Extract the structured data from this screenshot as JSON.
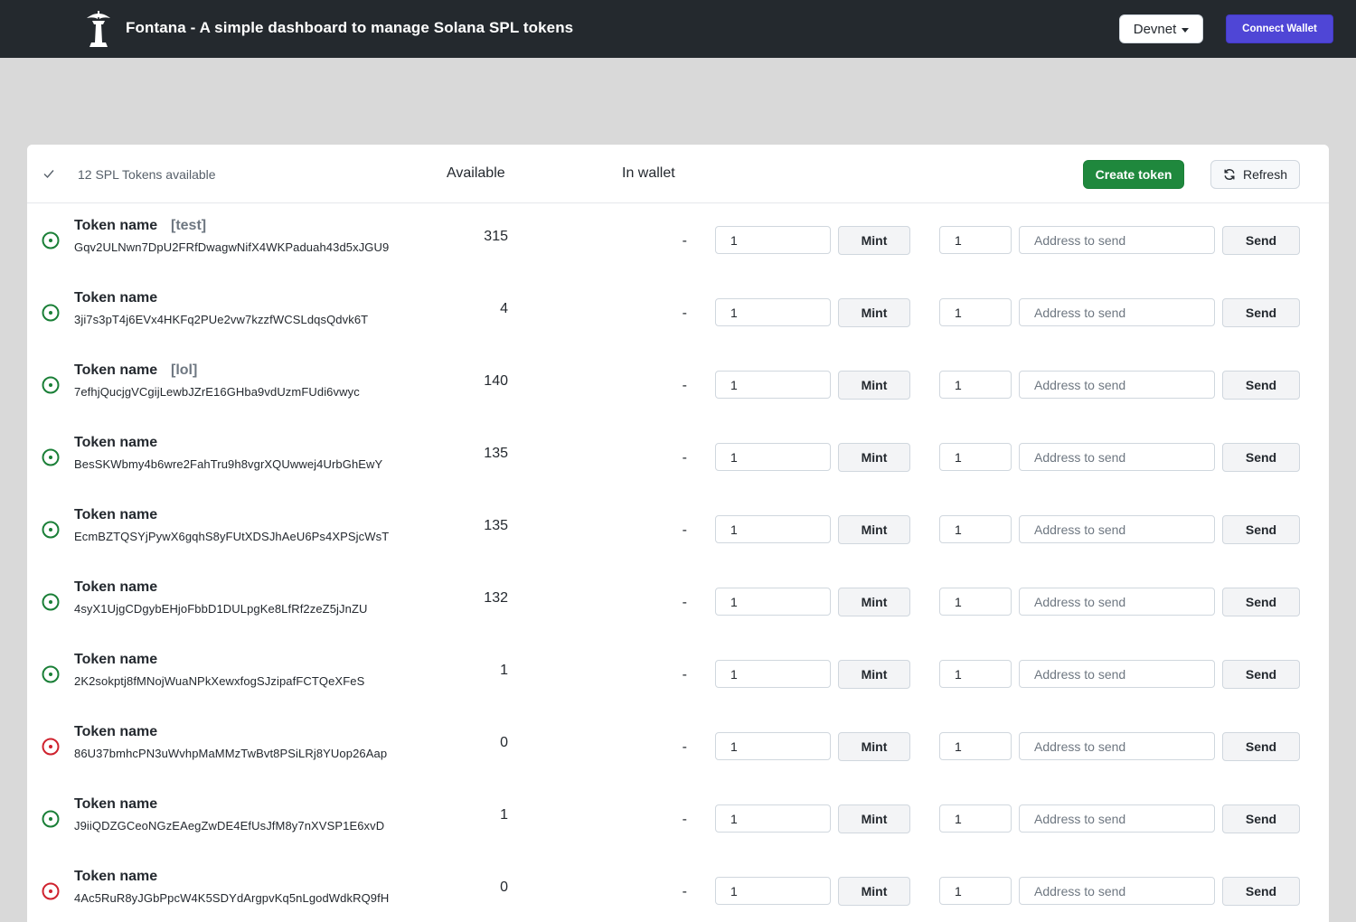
{
  "navbar": {
    "title": "Fontana - A simple dashboard to manage Solana SPL tokens",
    "network": "Devnet",
    "connect_label": "Connect Wallet",
    "logo_icon": "fountain-logo-icon"
  },
  "header": {
    "count_label": "12 SPL Tokens available",
    "available_label": "Available",
    "in_wallet_label": "In wallet",
    "create_label": "Create token",
    "refresh_label": "Refresh"
  },
  "colors": {
    "active": "#1a7f37",
    "inactive": "#cf222e",
    "create": "#1f883d",
    "connect": "#4f46d6",
    "navbar": "#24292e"
  },
  "tokens": [
    {
      "name": "Token name",
      "tag": "[test]",
      "address": "Gqv2ULNwn7DpU2FRfDwagwNifX4WKPaduah43d5xJGU9",
      "available": "315",
      "in_wallet": "-",
      "mint_qty": "1",
      "mint_label": "Mint",
      "send_qty": "1",
      "address_placeholder": "Address to send",
      "send_label": "Send",
      "status": "active"
    },
    {
      "name": "Token name",
      "tag": "",
      "address": "3ji7s3pT4j6EVx4HKFq2PUe2vw7kzzfWCSLdqsQdvk6T",
      "available": "4",
      "in_wallet": "-",
      "mint_qty": "1",
      "mint_label": "Mint",
      "send_qty": "1",
      "address_placeholder": "Address to send",
      "send_label": "Send",
      "status": "active"
    },
    {
      "name": "Token name",
      "tag": "[lol]",
      "address": "7efhjQucjgVCgijLewbJZrE16GHba9vdUzmFUdi6vwyc",
      "available": "140",
      "in_wallet": "-",
      "mint_qty": "1",
      "mint_label": "Mint",
      "send_qty": "1",
      "address_placeholder": "Address to send",
      "send_label": "Send",
      "status": "active"
    },
    {
      "name": "Token name",
      "tag": "",
      "address": "BesSKWbmy4b6wre2FahTru9h8vgrXQUwwej4UrbGhEwY",
      "available": "135",
      "in_wallet": "-",
      "mint_qty": "1",
      "mint_label": "Mint",
      "send_qty": "1",
      "address_placeholder": "Address to send",
      "send_label": "Send",
      "status": "active"
    },
    {
      "name": "Token name",
      "tag": "",
      "address": "EcmBZTQSYjPywX6gqhS8yFUtXDSJhAeU6Ps4XPSjcWsT",
      "available": "135",
      "in_wallet": "-",
      "mint_qty": "1",
      "mint_label": "Mint",
      "send_qty": "1",
      "address_placeholder": "Address to send",
      "send_label": "Send",
      "status": "active"
    },
    {
      "name": "Token name",
      "tag": "",
      "address": "4syX1UjgCDgybEHjoFbbD1DULpgKe8LfRf2zeZ5jJnZU",
      "available": "132",
      "in_wallet": "-",
      "mint_qty": "1",
      "mint_label": "Mint",
      "send_qty": "1",
      "address_placeholder": "Address to send",
      "send_label": "Send",
      "status": "active"
    },
    {
      "name": "Token name",
      "tag": "",
      "address": "2K2sokptj8fMNojWuaNPkXewxfogSJzipafFCTQeXFeS",
      "available": "1",
      "in_wallet": "-",
      "mint_qty": "1",
      "mint_label": "Mint",
      "send_qty": "1",
      "address_placeholder": "Address to send",
      "send_label": "Send",
      "status": "active"
    },
    {
      "name": "Token name",
      "tag": "",
      "address": "86U37bmhcPN3uWvhpMaMMzTwBvt8PSiLRj8YUop26Aap",
      "available": "0",
      "in_wallet": "-",
      "mint_qty": "1",
      "mint_label": "Mint",
      "send_qty": "1",
      "address_placeholder": "Address to send",
      "send_label": "Send",
      "status": "inactive"
    },
    {
      "name": "Token name",
      "tag": "",
      "address": "J9iiQDZGCeoNGzEAegZwDE4EfUsJfM8y7nXVSP1E6xvD",
      "available": "1",
      "in_wallet": "-",
      "mint_qty": "1",
      "mint_label": "Mint",
      "send_qty": "1",
      "address_placeholder": "Address to send",
      "send_label": "Send",
      "status": "active"
    },
    {
      "name": "Token name",
      "tag": "",
      "address": "4Ac5RuR8yJGbPpcW4K5SDYdArgpvKq5nLgodWdkRQ9fH",
      "available": "0",
      "in_wallet": "-",
      "mint_qty": "1",
      "mint_label": "Mint",
      "send_qty": "1",
      "address_placeholder": "Address to send",
      "send_label": "Send",
      "status": "inactive"
    }
  ]
}
